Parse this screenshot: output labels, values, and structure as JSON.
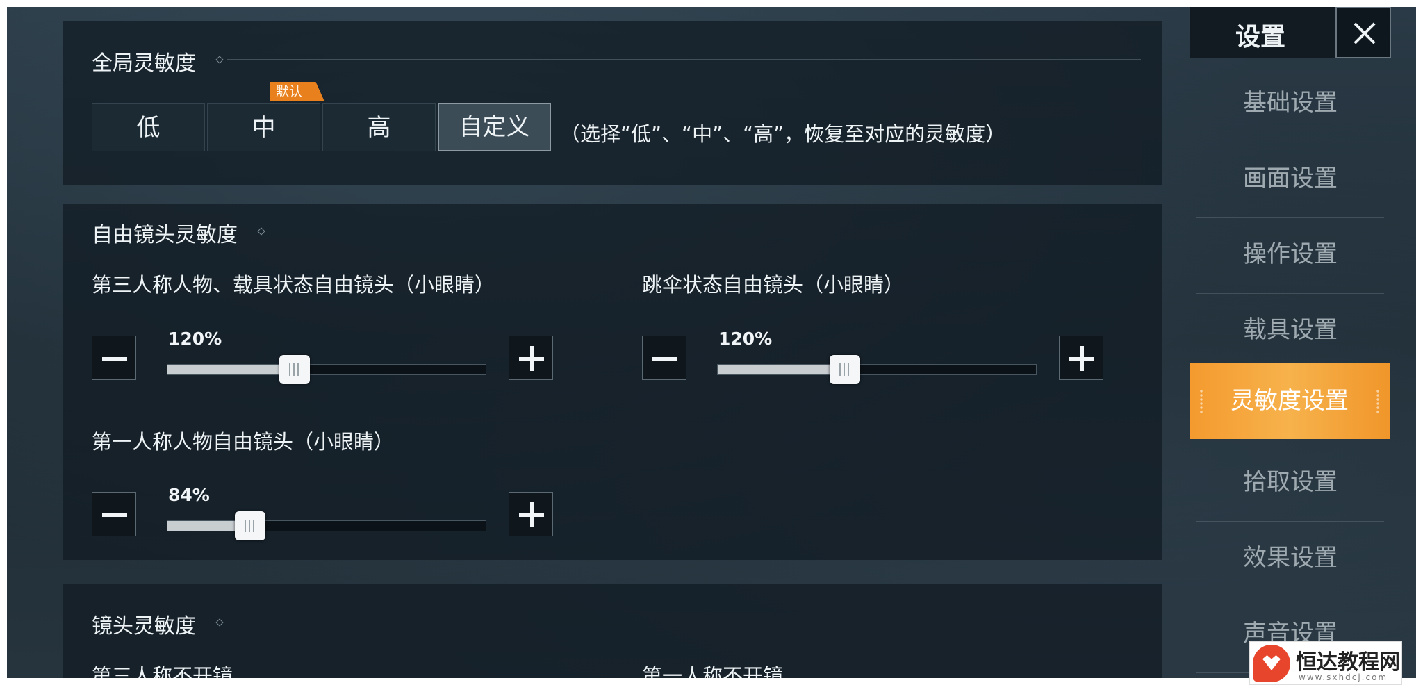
{
  "global_sensitivity": {
    "title": "全局灵敏度",
    "presets": [
      {
        "label": "低"
      },
      {
        "label": "中"
      },
      {
        "label": "高"
      },
      {
        "label": "自定义"
      }
    ],
    "selected": "自定义",
    "default_tag": "默认",
    "note": "（选择“低”、“中”、“高”，恢复至对应的灵敏度）"
  },
  "free_camera": {
    "title": "自由镜头灵敏度",
    "sliders": [
      {
        "label": "第三人称人物、载具状态自由镜头（小眼睛）",
        "value_text": "120%",
        "level": 0.4
      },
      {
        "label": "跳伞状态自由镜头（小眼睛）",
        "value_text": "120%",
        "level": 0.4
      },
      {
        "label": "第一人称人物自由镜头（小眼睛）",
        "value_text": "84%",
        "level": 0.26
      }
    ]
  },
  "camera": {
    "title": "镜头灵敏度",
    "items": [
      {
        "label": "第三人称不开镜"
      },
      {
        "label": "第一人称不开镜"
      }
    ]
  },
  "nav": {
    "title": "设置",
    "items": [
      {
        "label": "基础设置"
      },
      {
        "label": "画面设置"
      },
      {
        "label": "操作设置"
      },
      {
        "label": "载具设置"
      },
      {
        "label": "灵敏度设置"
      },
      {
        "label": "拾取设置"
      },
      {
        "label": "效果设置"
      },
      {
        "label": "声音设置"
      }
    ],
    "active": "灵敏度设置"
  },
  "watermark": {
    "name": "恒达教程网",
    "url": "www.sxhdcj.com"
  },
  "colors": {
    "accent": "#f49a2e",
    "default_tag": "#e8801e"
  }
}
